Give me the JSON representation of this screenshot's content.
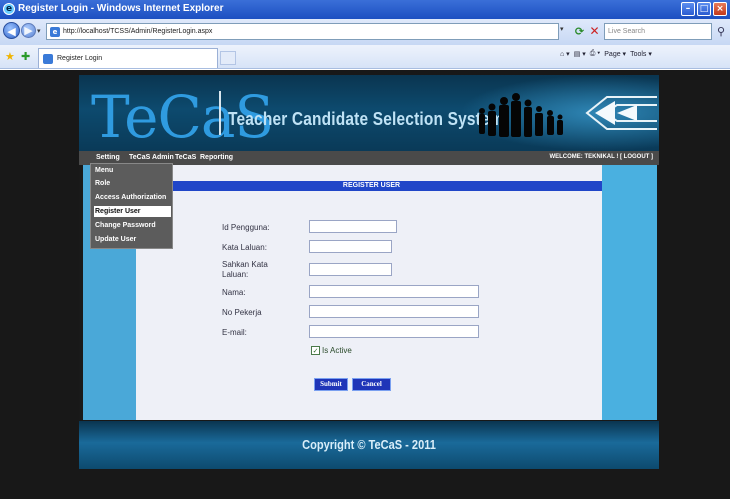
{
  "window": {
    "title": "Register Login - Windows Internet Explorer",
    "url": "http://localhost/TCSS/Admin/RegisterLogin.aspx",
    "search_placeholder": "Live Search",
    "tab_label": "Register Login",
    "commands": [
      "Page ▾",
      "Tools ▾"
    ]
  },
  "site": {
    "logo": "TeCaS",
    "system_name": "Teacher Candidate Selection System",
    "menu": [
      "Setting",
      "TeCaS Admin",
      "TeCaS",
      "Reporting"
    ],
    "welcome": "WELCOME: TEKNIKAL ! [ LOGOUT ]",
    "dropdown": [
      "Menu",
      "Role",
      "Access Authorization",
      "Register User",
      "Change Password",
      "Update User"
    ],
    "dropdown_selected": "Register User"
  },
  "form": {
    "header": "REGISTER USER",
    "fields": [
      {
        "label": "Id Pengguna:",
        "value": ""
      },
      {
        "label": "Kata Laluan:",
        "value": ""
      },
      {
        "label": "Sahkan Kata Laluan:",
        "value": ""
      },
      {
        "label": "Nama:",
        "value": ""
      },
      {
        "label": "No Pekerja",
        "value": ""
      },
      {
        "label": "E-mail:",
        "value": ""
      }
    ],
    "checkbox_label": "Is Active",
    "checkbox_checked": true,
    "submit_label": "Submit",
    "cancel_label": "Cancel"
  },
  "footer": {
    "copyright": "Copyright © TeCaS - 2011"
  }
}
